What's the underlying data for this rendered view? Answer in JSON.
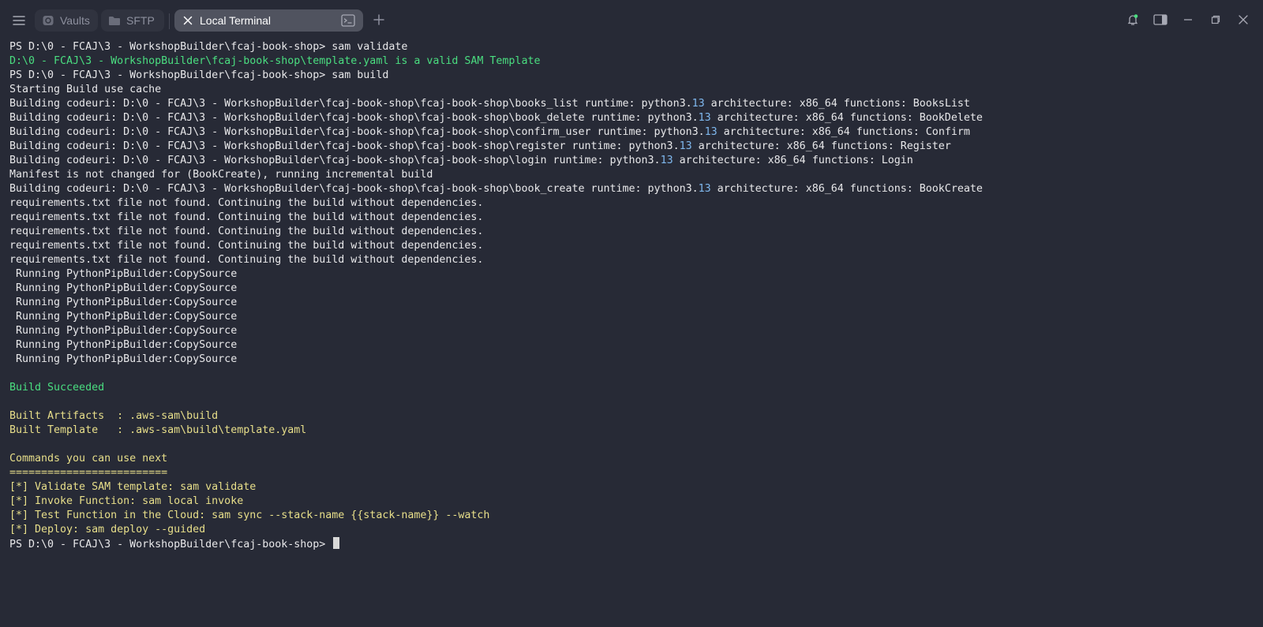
{
  "titlebar": {
    "tabs": [
      {
        "label": "Vaults"
      },
      {
        "label": "SFTP"
      },
      {
        "label": "Local Terminal"
      }
    ]
  },
  "colors": {
    "background": "#272a36",
    "success_green": "#4ade80",
    "info_yellow": "#e8df8a",
    "number_blue": "#7fb8ee",
    "active_tab": "#50535f"
  },
  "icons": {
    "menu": "hamburger-icon",
    "vaults": "vault-icon",
    "sftp": "folder-icon",
    "close_tab": "close-icon",
    "terminal": "terminal-icon",
    "new_tab": "plus-icon",
    "notifications": "bell-icon",
    "sidebar": "sidebar-toggle-icon",
    "minimize": "minimize-icon",
    "restore": "restore-icon",
    "close_window": "close-window-icon"
  },
  "terminal": {
    "lines": [
      [
        {
          "t": "PS D:\\0 - FCAJ\\3 - WorkshopBuilder\\fcaj-book-shop> sam validate"
        }
      ],
      [
        {
          "t": "D:\\0 - FCAJ\\3 - WorkshopBuilder\\fcaj-book-shop\\template.yaml is a valid SAM Template",
          "c": "green"
        }
      ],
      [
        {
          "t": "PS D:\\0 - FCAJ\\3 - WorkshopBuilder\\fcaj-book-shop> sam build"
        }
      ],
      [
        {
          "t": "Starting Build use cache"
        }
      ],
      [
        {
          "t": "Building codeuri: D:\\0 - FCAJ\\3 - WorkshopBuilder\\fcaj-book-shop\\fcaj-book-shop\\books_list runtime: python3."
        },
        {
          "t": "13",
          "c": "num"
        },
        {
          "t": " architecture: x86_64 functions: BooksList"
        }
      ],
      [
        {
          "t": "Building codeuri: D:\\0 - FCAJ\\3 - WorkshopBuilder\\fcaj-book-shop\\fcaj-book-shop\\book_delete runtime: python3."
        },
        {
          "t": "13",
          "c": "num"
        },
        {
          "t": " architecture: x86_64 functions: BookDelete"
        }
      ],
      [
        {
          "t": "Building codeuri: D:\\0 - FCAJ\\3 - WorkshopBuilder\\fcaj-book-shop\\fcaj-book-shop\\confirm_user runtime: python3."
        },
        {
          "t": "13",
          "c": "num"
        },
        {
          "t": " architecture: x86_64 functions: Confirm"
        }
      ],
      [
        {
          "t": "Building codeuri: D:\\0 - FCAJ\\3 - WorkshopBuilder\\fcaj-book-shop\\fcaj-book-shop\\register runtime: python3."
        },
        {
          "t": "13",
          "c": "num"
        },
        {
          "t": " architecture: x86_64 functions: Register"
        }
      ],
      [
        {
          "t": "Building codeuri: D:\\0 - FCAJ\\3 - WorkshopBuilder\\fcaj-book-shop\\fcaj-book-shop\\login runtime: python3."
        },
        {
          "t": "13",
          "c": "num"
        },
        {
          "t": " architecture: x86_64 functions: Login"
        }
      ],
      [
        {
          "t": "Manifest is not changed for (BookCreate), running incremental build"
        }
      ],
      [
        {
          "t": "Building codeuri: D:\\0 - FCAJ\\3 - WorkshopBuilder\\fcaj-book-shop\\fcaj-book-shop\\book_create runtime: python3."
        },
        {
          "t": "13",
          "c": "num"
        },
        {
          "t": " architecture: x86_64 functions: BookCreate"
        }
      ],
      [
        {
          "t": "requirements.txt file not found. Continuing the build without dependencies."
        }
      ],
      [
        {
          "t": "requirements.txt file not found. Continuing the build without dependencies."
        }
      ],
      [
        {
          "t": "requirements.txt file not found. Continuing the build without dependencies."
        }
      ],
      [
        {
          "t": "requirements.txt file not found. Continuing the build without dependencies."
        }
      ],
      [
        {
          "t": "requirements.txt file not found. Continuing the build without dependencies."
        }
      ],
      [
        {
          "t": " Running PythonPipBuilder:CopySource"
        }
      ],
      [
        {
          "t": " Running PythonPipBuilder:CopySource"
        }
      ],
      [
        {
          "t": " Running PythonPipBuilder:CopySource"
        }
      ],
      [
        {
          "t": " Running PythonPipBuilder:CopySource"
        }
      ],
      [
        {
          "t": " Running PythonPipBuilder:CopySource"
        }
      ],
      [
        {
          "t": " Running PythonPipBuilder:CopySource"
        }
      ],
      [
        {
          "t": " Running PythonPipBuilder:CopySource"
        }
      ],
      [],
      [
        {
          "t": "Build Succeeded",
          "c": "green"
        }
      ],
      [],
      [
        {
          "t": "Built Artifacts  : .aws-sam\\build",
          "c": "yellow"
        }
      ],
      [
        {
          "t": "Built Template   : .aws-sam\\build\\template.yaml",
          "c": "yellow"
        }
      ],
      [],
      [
        {
          "t": "Commands you can use next",
          "c": "yellow"
        }
      ],
      [
        {
          "t": "=========================",
          "c": "yellow"
        }
      ],
      [
        {
          "t": "[*] Validate SAM template: sam validate",
          "c": "yellow"
        }
      ],
      [
        {
          "t": "[*] Invoke Function: sam local invoke",
          "c": "yellow"
        }
      ],
      [
        {
          "t": "[*] Test Function in the Cloud: sam sync --stack-name {{stack-name}} --watch",
          "c": "yellow"
        }
      ],
      [
        {
          "t": "[*] Deploy: sam deploy --guided",
          "c": "yellow"
        }
      ]
    ],
    "prompt": "PS D:\\0 - FCAJ\\3 - WorkshopBuilder\\fcaj-book-shop> "
  }
}
